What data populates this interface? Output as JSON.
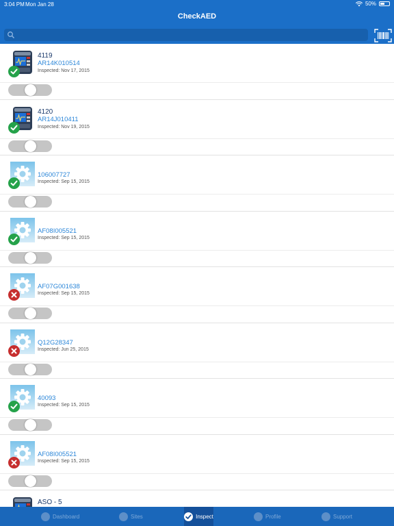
{
  "status_bar": {
    "time": "3:04 PM",
    "date": "Mon Jan 28",
    "battery": "50%",
    "battery_level": 0.5
  },
  "header": {
    "title": "CheckAED"
  },
  "search": {
    "value": "",
    "placeholder": ""
  },
  "icons": {
    "search": "search-icon",
    "barcode": "barcode-scan-icon",
    "ok": "check-icon",
    "fail": "x-icon",
    "aed_device": "aed-device-icon",
    "placeholder_gear": "gear-icon"
  },
  "colors": {
    "header_bg": "#1b6fc8",
    "ok_green": "#25a24a",
    "fail_red": "#c62e2e",
    "link_blue": "#2b86d8"
  },
  "items": [
    {
      "name": "4119",
      "serial": "AR14K010514",
      "inspected": "Inspected: Nov 17, 2015",
      "status": "ok",
      "thumb": "aed"
    },
    {
      "name": "4120",
      "serial": "AR14J010411",
      "inspected": "Inspected: Nov 19, 2015",
      "status": "ok",
      "thumb": "aed"
    },
    {
      "name": "",
      "serial": "106007727",
      "inspected": "Inspected: Sep 15, 2015",
      "status": "ok",
      "thumb": "gear"
    },
    {
      "name": "",
      "serial": "AF08I005521",
      "inspected": "Inspected: Sep 15, 2015",
      "status": "ok",
      "thumb": "gear"
    },
    {
      "name": "",
      "serial": "AF07G001638",
      "inspected": "Inspected: Sep 15, 2015",
      "status": "fail",
      "thumb": "gear"
    },
    {
      "name": "",
      "serial": "Q12G28347",
      "inspected": "Inspected: Jun 25, 2015",
      "status": "fail",
      "thumb": "gear"
    },
    {
      "name": "",
      "serial": "40093",
      "inspected": "Inspected: Sep 15, 2015",
      "status": "ok",
      "thumb": "gear"
    },
    {
      "name": "",
      "serial": "AF08I005521",
      "inspected": "Inspected: Sep 15, 2015",
      "status": "fail",
      "thumb": "gear"
    },
    {
      "name": "ASO - 5",
      "serial": "",
      "inspected": "",
      "status": "",
      "thumb": "aed"
    }
  ],
  "tabs": [
    {
      "label": "Dashboard",
      "active": false
    },
    {
      "label": "Sites",
      "active": false
    },
    {
      "label": "Inspect",
      "active": true
    },
    {
      "label": "Profile",
      "active": false
    },
    {
      "label": "Support",
      "active": false
    }
  ]
}
